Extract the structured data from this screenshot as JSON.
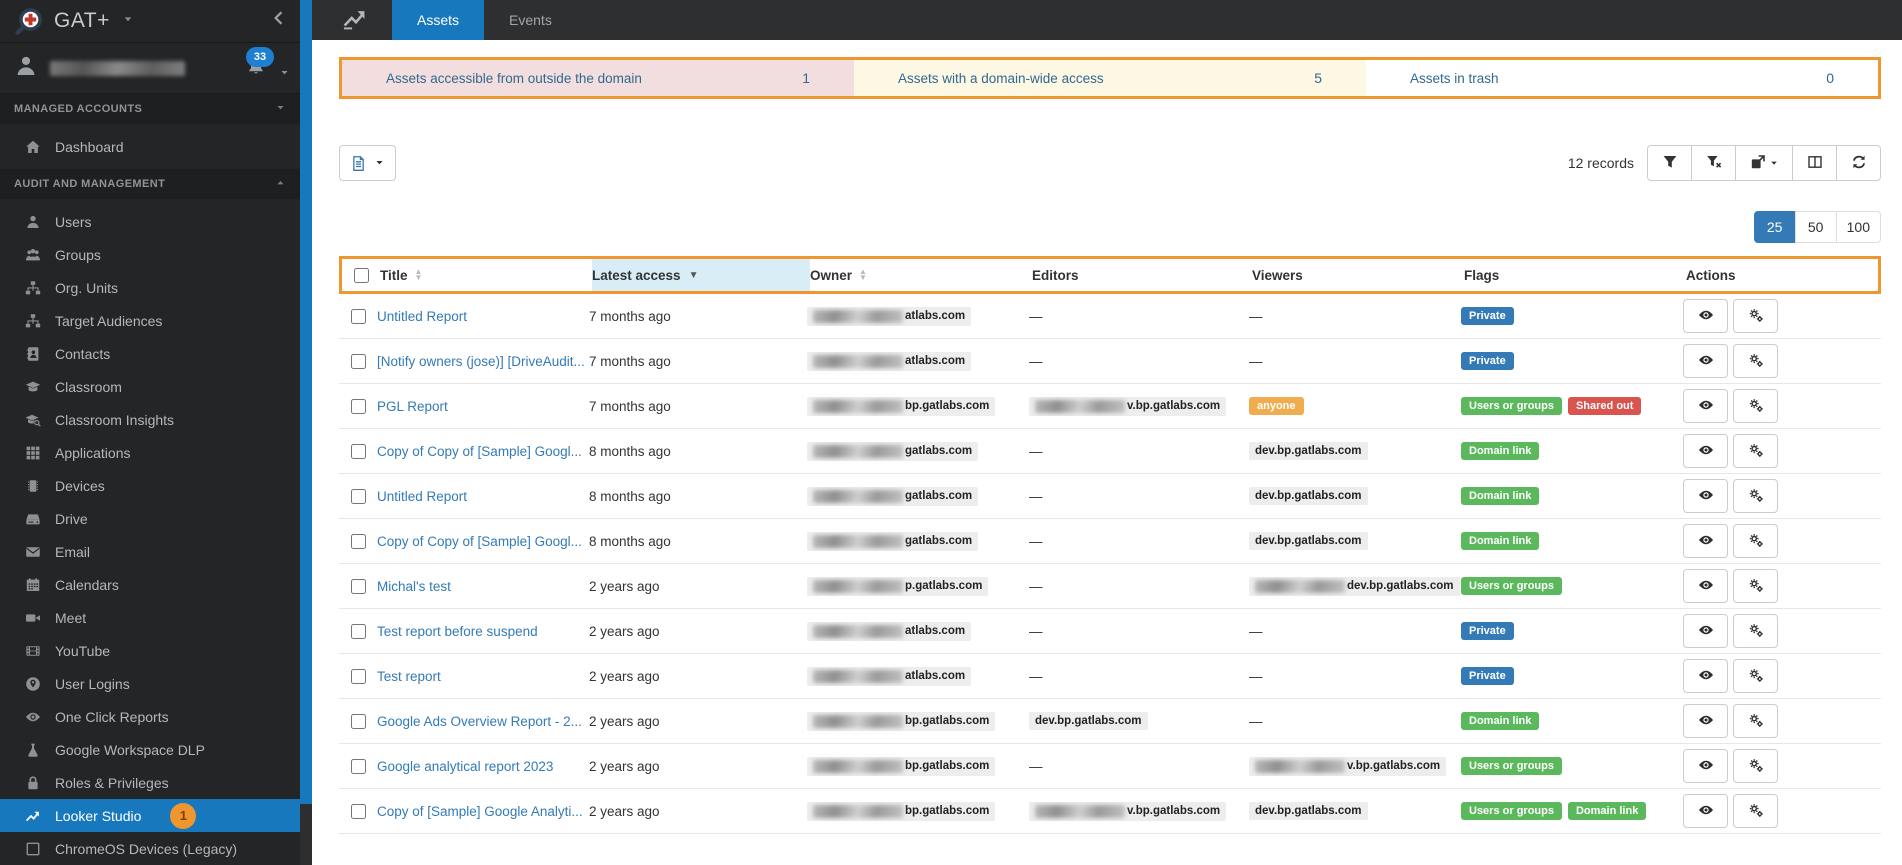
{
  "app": {
    "logo_text": "GAT+"
  },
  "colors": {
    "accent_orange": "#f0962e",
    "active_blue": "#1878bd",
    "link_blue": "#337ab7",
    "sorted_header_bg": "#d9edf7",
    "summary_pink": "#f2dede",
    "summary_yellow": "#fcf8e3",
    "summary_white": "#ffffff"
  },
  "sidebar": {
    "notifications_count": "33",
    "sections": [
      {
        "label": "MANAGED ACCOUNTS"
      },
      {
        "label": "AUDIT AND MANAGEMENT"
      }
    ],
    "top_items": [
      {
        "id": "dashboard",
        "label": "Dashboard",
        "icon": "home"
      }
    ],
    "items": [
      {
        "id": "users",
        "label": "Users",
        "icon": "person"
      },
      {
        "id": "groups",
        "label": "Groups",
        "icon": "group"
      },
      {
        "id": "org-units",
        "label": "Org. Units",
        "icon": "sitemap"
      },
      {
        "id": "target-audiences",
        "label": "Target Audiences",
        "icon": "sitemap"
      },
      {
        "id": "contacts",
        "label": "Contacts",
        "icon": "contacts"
      },
      {
        "id": "classroom",
        "label": "Classroom",
        "icon": "graduation-cap"
      },
      {
        "id": "classroom-insights",
        "label": "Classroom Insights",
        "icon": "graduation-search"
      },
      {
        "id": "applications",
        "label": "Applications",
        "icon": "grid"
      },
      {
        "id": "devices",
        "label": "Devices",
        "icon": "chip"
      },
      {
        "id": "drive",
        "label": "Drive",
        "icon": "hdd"
      },
      {
        "id": "email",
        "label": "Email",
        "icon": "envelope"
      },
      {
        "id": "calendars",
        "label": "Calendars",
        "icon": "calendar"
      },
      {
        "id": "meet",
        "label": "Meet",
        "icon": "video"
      },
      {
        "id": "youtube",
        "label": "YouTube",
        "icon": "film"
      },
      {
        "id": "user-logins",
        "label": "User Logins",
        "icon": "globe-pin"
      },
      {
        "id": "one-click-reports",
        "label": "One Click Reports",
        "icon": "eye"
      },
      {
        "id": "google-workspace-dlp",
        "label": "Google Workspace DLP",
        "icon": "flask"
      },
      {
        "id": "roles-privileges",
        "label": "Roles & Privileges",
        "icon": "lock"
      },
      {
        "id": "looker-studio",
        "label": "Looker Studio",
        "icon": "chart-line",
        "active": true,
        "badge": "1"
      },
      {
        "id": "chromeos-devices-legacy",
        "label": "ChromeOS Devices (Legacy)",
        "icon": "square"
      }
    ]
  },
  "topbar": {
    "tabs": [
      {
        "label": "Assets",
        "active": true
      },
      {
        "label": "Events"
      }
    ]
  },
  "summary": {
    "cards": [
      {
        "id": "outside-domain",
        "label": "Assets accessible from outside the domain",
        "value": "1",
        "bg": "#f2dede"
      },
      {
        "id": "domain-wide",
        "label": "Assets with a domain-wide access",
        "value": "5",
        "bg": "#fcf8e3"
      },
      {
        "id": "trash",
        "label": "Assets in trash",
        "value": "0",
        "bg": "#ffffff"
      }
    ]
  },
  "toolbar": {
    "records_text": "12 records",
    "buttons": [
      {
        "id": "filter",
        "icon": "funnel"
      },
      {
        "id": "clear-filter",
        "icon": "funnel-x"
      },
      {
        "id": "export",
        "icon": "export",
        "caret": true
      },
      {
        "id": "columns",
        "icon": "columns"
      },
      {
        "id": "refresh",
        "icon": "refresh"
      }
    ],
    "page_sizes": [
      {
        "label": "25",
        "active": true
      },
      {
        "label": "50"
      },
      {
        "label": "100"
      }
    ]
  },
  "table": {
    "empty_placeholder": "—",
    "flag_styles": {
      "Private": "#337ab7",
      "Users or groups": "#5cb85c",
      "Domain link": "#5cb85c",
      "Shared out": "#d9534f",
      "anyone": "#f0ad4e"
    },
    "columns": [
      {
        "id": "select",
        "type": "checkbox",
        "label": ""
      },
      {
        "id": "title",
        "label": "Title",
        "sort": "both"
      },
      {
        "id": "latest-access",
        "label": "Latest access",
        "sort": "desc",
        "highlight": true
      },
      {
        "id": "owner",
        "label": "Owner",
        "sort": "both"
      },
      {
        "id": "editors",
        "label": "Editors"
      },
      {
        "id": "viewers",
        "label": "Viewers"
      },
      {
        "id": "flags",
        "label": "Flags"
      },
      {
        "id": "actions",
        "label": "Actions"
      }
    ],
    "row_actions": [
      {
        "id": "preview",
        "icon": "eye"
      },
      {
        "id": "manage",
        "icon": "gears"
      }
    ],
    "rows": [
      {
        "title": "Untitled Report",
        "latest_access": "7 months ago",
        "owner": {
          "blur": true,
          "suffix": "atlabs.com"
        },
        "editors": {
          "dash": true
        },
        "viewers": {
          "dash": true
        },
        "flags": [
          "Private"
        ]
      },
      {
        "title": "[Notify owners (jose)] [DriveAudit...",
        "latest_access": "7 months ago",
        "owner": {
          "blur": true,
          "suffix": "atlabs.com"
        },
        "editors": {
          "dash": true
        },
        "viewers": {
          "dash": true
        },
        "flags": [
          "Private"
        ]
      },
      {
        "title": "PGL Report",
        "latest_access": "7 months ago",
        "owner": {
          "blur": true,
          "suffix": "bp.gatlabs.com"
        },
        "editors": {
          "blur": true,
          "suffix": "v.bp.gatlabs.com"
        },
        "viewers": {
          "badge": "anyone"
        },
        "flags": [
          "Users or groups",
          "Shared out"
        ]
      },
      {
        "title": "Copy of Copy of [Sample] Googl...",
        "latest_access": "8 months ago",
        "owner": {
          "blur": true,
          "suffix": "gatlabs.com"
        },
        "editors": {
          "dash": true
        },
        "viewers": {
          "text": "dev.bp.gatlabs.com"
        },
        "flags": [
          "Domain link"
        ]
      },
      {
        "title": "Untitled Report",
        "latest_access": "8 months ago",
        "owner": {
          "blur": true,
          "suffix": "gatlabs.com"
        },
        "editors": {
          "dash": true
        },
        "viewers": {
          "text": "dev.bp.gatlabs.com"
        },
        "flags": [
          "Domain link"
        ]
      },
      {
        "title": "Copy of Copy of [Sample] Googl...",
        "latest_access": "8 months ago",
        "owner": {
          "blur": true,
          "suffix": "gatlabs.com"
        },
        "editors": {
          "dash": true
        },
        "viewers": {
          "text": "dev.bp.gatlabs.com"
        },
        "flags": [
          "Domain link"
        ]
      },
      {
        "title": "Michal's test",
        "latest_access": "2 years ago",
        "owner": {
          "blur": true,
          "suffix": "p.gatlabs.com"
        },
        "editors": {
          "dash": true
        },
        "viewers": {
          "blur": true,
          "suffix": "dev.bp.gatlabs.com"
        },
        "flags": [
          "Users or groups"
        ]
      },
      {
        "title": "Test report before suspend",
        "latest_access": "2 years ago",
        "owner": {
          "blur": true,
          "suffix": "atlabs.com"
        },
        "editors": {
          "dash": true
        },
        "viewers": {
          "dash": true
        },
        "flags": [
          "Private"
        ]
      },
      {
        "title": "Test report",
        "latest_access": "2 years ago",
        "owner": {
          "blur": true,
          "suffix": "atlabs.com"
        },
        "editors": {
          "dash": true
        },
        "viewers": {
          "dash": true
        },
        "flags": [
          "Private"
        ]
      },
      {
        "title": "Google Ads Overview Report - 2...",
        "latest_access": "2 years ago",
        "owner": {
          "blur": true,
          "suffix": "bp.gatlabs.com"
        },
        "editors": {
          "text": "dev.bp.gatlabs.com"
        },
        "viewers": {
          "dash": true
        },
        "flags": [
          "Domain link"
        ]
      },
      {
        "title": "Google analytical report 2023",
        "latest_access": "2 years ago",
        "owner": {
          "blur": true,
          "suffix": "bp.gatlabs.com"
        },
        "editors": {
          "dash": true
        },
        "viewers": {
          "blur": true,
          "suffix": "v.bp.gatlabs.com"
        },
        "flags": [
          "Users or groups"
        ]
      },
      {
        "title": "Copy of [Sample] Google Analyti...",
        "latest_access": "2 years ago",
        "owner": {
          "blur": true,
          "suffix": "bp.gatlabs.com"
        },
        "editors": {
          "blur": true,
          "suffix": "v.bp.gatlabs.com"
        },
        "viewers": {
          "text": "dev.bp.gatlabs.com"
        },
        "flags": [
          "Users or groups",
          "Domain link"
        ]
      }
    ]
  }
}
